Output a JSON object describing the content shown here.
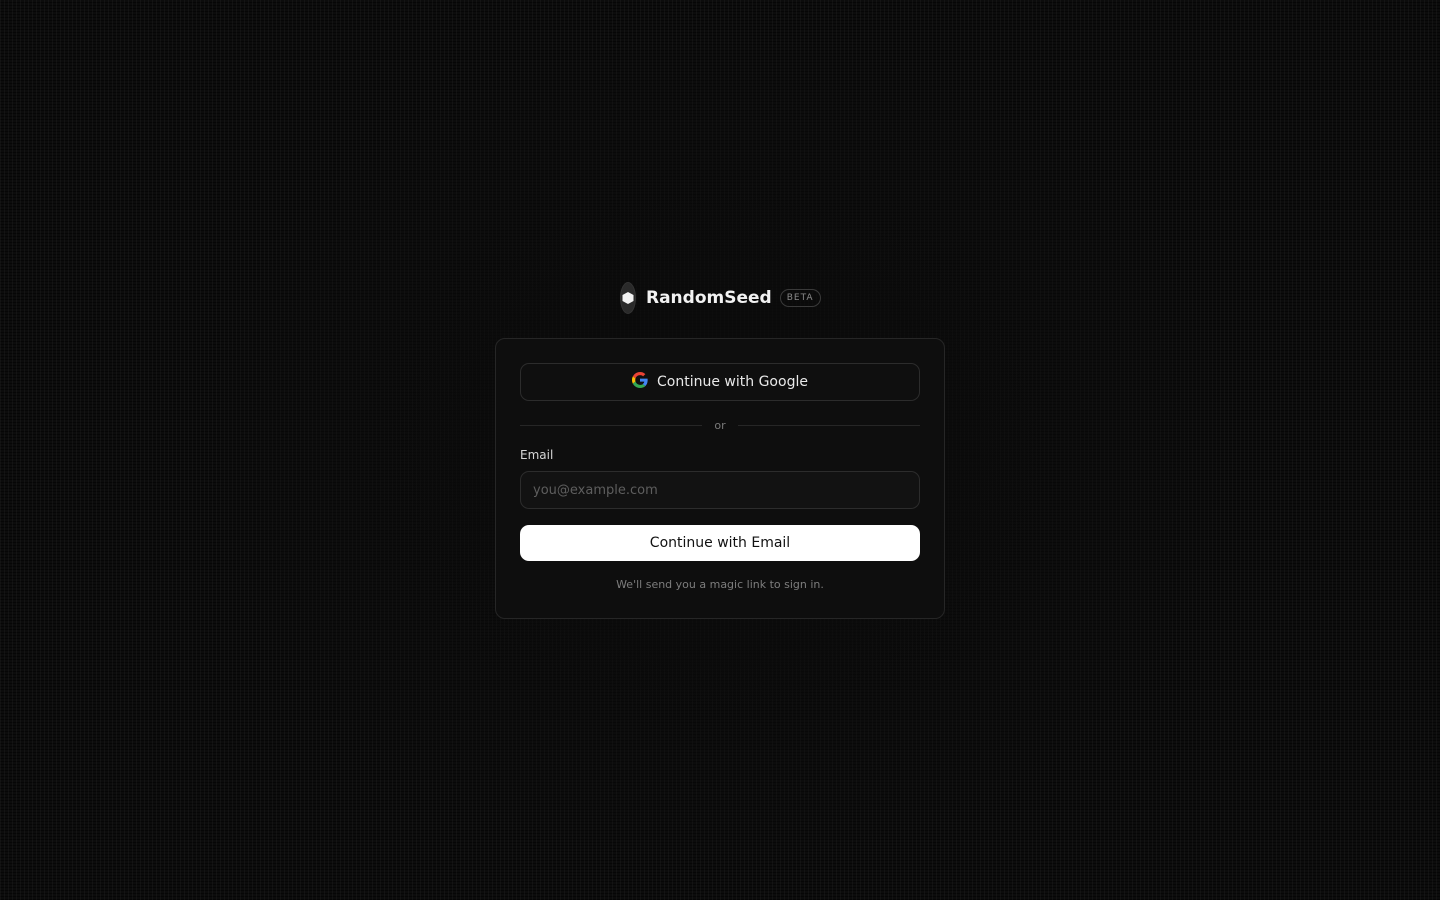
{
  "brand": {
    "name": "RandomSeed",
    "badge": "BETA",
    "logo_icon": "hexagon-icon"
  },
  "auth": {
    "google_button_label": "Continue with Google",
    "google_icon": "google-icon",
    "divider_text": "or",
    "email_label": "Email",
    "email_placeholder": "you@example.com",
    "email_value": "",
    "email_button_label": "Continue with Email",
    "hint": "We'll send you a magic link to sign in."
  },
  "colors": {
    "background": "#0b0b0b",
    "card": "#0e0e0e",
    "primary_button": "#ffffff",
    "google_blue": "#4285F4",
    "google_red": "#EA4335",
    "google_yellow": "#FBBC05",
    "google_green": "#34A853"
  }
}
